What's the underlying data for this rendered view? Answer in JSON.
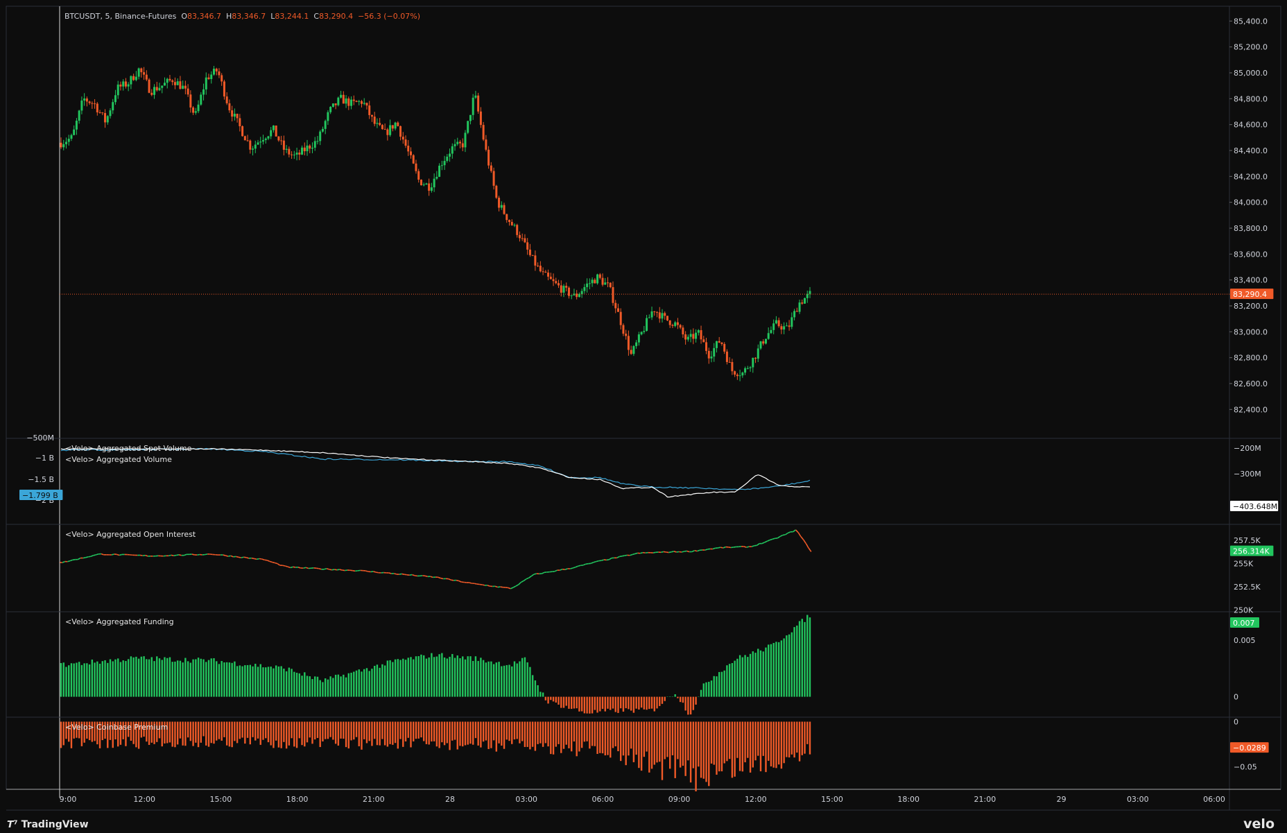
{
  "header": {
    "symbol": "BTCUSDT, 5, Binance-Futures",
    "open_label": "O",
    "open": "83,346.7",
    "high_label": "H",
    "high": "83,346.7",
    "low_label": "L",
    "low": "83,244.1",
    "close_label": "C",
    "close": "83,290.4",
    "change": "−56.3 (−0.07%)"
  },
  "branding": {
    "left": "TradingView",
    "right": "velo"
  },
  "colors": {
    "up": "#22c55e",
    "down": "#f05a28",
    "background": "#0d0d0d",
    "grid_border": "#2a2e39",
    "text": "#d1d4dc",
    "volume_spot": "#ffffff",
    "volume_agg": "#3ba6d8"
  },
  "chart_data": [
    {
      "id": "price",
      "type": "candlestick",
      "title": "",
      "ylim": [
        82300,
        85450
      ],
      "y_ticks": [
        "85,400.0",
        "85,200.0",
        "85,000.0",
        "84,800.0",
        "84,600.0",
        "84,400.0",
        "84,200.0",
        "84,000.0",
        "83,800.0",
        "83,600.0",
        "83,400.0",
        "83,200.0",
        "83,000.0",
        "82,800.0",
        "82,600.0",
        "82,400.0"
      ],
      "last_price_label": "83,290.4",
      "last_price": 83290.4,
      "keypoints": [
        [
          "09:00",
          84460
        ],
        [
          "09:20",
          84500
        ],
        [
          "10:00",
          84800
        ],
        [
          "10:40",
          84760
        ],
        [
          "11:10",
          84620
        ],
        [
          "11:40",
          84880
        ],
        [
          "12:00",
          84920
        ],
        [
          "12:20",
          85030
        ],
        [
          "12:40",
          84860
        ],
        [
          "13:20",
          84900
        ],
        [
          "14:00",
          84950
        ],
        [
          "14:40",
          84880
        ],
        [
          "15:00",
          84660
        ],
        [
          "15:30",
          84960
        ],
        [
          "15:50",
          85020
        ],
        [
          "16:10",
          84740
        ],
        [
          "16:40",
          84580
        ],
        [
          "17:10",
          84420
        ],
        [
          "17:40",
          84500
        ],
        [
          "18:10",
          84560
        ],
        [
          "18:40",
          84400
        ],
        [
          "19:10",
          84350
        ],
        [
          "19:40",
          84420
        ],
        [
          "20:10",
          84480
        ],
        [
          "20:40",
          84700
        ],
        [
          "21:20",
          84800
        ],
        [
          "21:50",
          84760
        ],
        [
          "22:20",
          84780
        ],
        [
          "22:50",
          84610
        ],
        [
          "23:20",
          84530
        ],
        [
          "23:50",
          84620
        ],
        [
          "00:10",
          84400
        ],
        [
          "00:40",
          84170
        ],
        [
          "01:00",
          84120
        ],
        [
          "01:20",
          84300
        ],
        [
          "01:40",
          84420
        ],
        [
          "02:00",
          84450
        ],
        [
          "02:20",
          84840
        ],
        [
          "02:40",
          84400
        ],
        [
          "03:00",
          84010
        ],
        [
          "03:20",
          83870
        ],
        [
          "03:40",
          83750
        ],
        [
          "04:10",
          83580
        ],
        [
          "04:40",
          83450
        ],
        [
          "05:00",
          83380
        ],
        [
          "05:30",
          83320
        ],
        [
          "05:50",
          83270
        ],
        [
          "06:20",
          83360
        ],
        [
          "06:50",
          83420
        ],
        [
          "07:20",
          83350
        ],
        [
          "07:40",
          83100
        ],
        [
          "07:50",
          82820
        ],
        [
          "08:00",
          83000
        ],
        [
          "08:30",
          83180
        ],
        [
          "09:00",
          83100
        ],
        [
          "09:30",
          83060
        ],
        [
          "10:00",
          82930
        ],
        [
          "10:30",
          82990
        ],
        [
          "11:00",
          82820
        ],
        [
          "11:30",
          82940
        ],
        [
          "11:50",
          82700
        ],
        [
          "12:20",
          82680
        ],
        [
          "12:40",
          82800
        ],
        [
          "13:10",
          82960
        ],
        [
          "13:40",
          83060
        ],
        [
          "14:00",
          83020
        ],
        [
          "14:10",
          83220
        ],
        [
          "14:20",
          83290
        ]
      ]
    },
    {
      "id": "volume",
      "type": "line",
      "series": [
        {
          "name": "<Velo> Aggregated Spot Volume"
        },
        {
          "name": "<Velo> Aggregated Volume"
        }
      ],
      "left_ticks": [
        "−500M",
        "−1 B",
        "−1.5 B",
        "−2 B"
      ],
      "right_ticks": [
        "−200M",
        "−300M"
      ],
      "left_value_label": "−1.799 B",
      "right_value_label": "−403.648M",
      "left_value": -1799000000,
      "right_value": -403648000,
      "series_keypoints": {
        "spot": [
          [
            0,
            0.1
          ],
          [
            0.2,
            0.1
          ],
          [
            0.27,
            0.12
          ],
          [
            0.35,
            0.16
          ],
          [
            0.45,
            0.25
          ],
          [
            0.55,
            0.3
          ],
          [
            0.6,
            0.33
          ],
          [
            0.64,
            0.4
          ],
          [
            0.68,
            0.55
          ],
          [
            0.72,
            0.58
          ],
          [
            0.75,
            0.72
          ],
          [
            0.79,
            0.7
          ],
          [
            0.81,
            0.85
          ],
          [
            0.87,
            0.78
          ],
          [
            0.9,
            0.78
          ],
          [
            0.93,
            0.5
          ],
          [
            0.96,
            0.68
          ],
          [
            1.0,
            0.7
          ]
        ],
        "agg": [
          [
            0,
            0.12
          ],
          [
            0.2,
            0.1
          ],
          [
            0.27,
            0.14
          ],
          [
            0.35,
            0.26
          ],
          [
            0.45,
            0.27
          ],
          [
            0.55,
            0.3
          ],
          [
            0.6,
            0.3
          ],
          [
            0.64,
            0.37
          ],
          [
            0.68,
            0.55
          ],
          [
            0.72,
            0.55
          ],
          [
            0.75,
            0.65
          ],
          [
            0.79,
            0.7
          ],
          [
            0.81,
            0.7
          ],
          [
            0.87,
            0.72
          ],
          [
            0.9,
            0.74
          ],
          [
            0.93,
            0.72
          ],
          [
            0.96,
            0.68
          ],
          [
            1.0,
            0.6
          ]
        ]
      }
    },
    {
      "id": "open_interest",
      "type": "line",
      "series": [
        {
          "name": "<Velo> Aggregated Open Interest"
        }
      ],
      "ylim": [
        249800,
        259200
      ],
      "y_ticks": [
        "257.5K",
        "255K",
        "252.5K",
        "250K"
      ],
      "last_value_label": "256.314K",
      "last_value": 256314,
      "keypoints": [
        [
          0,
          255.1
        ],
        [
          0.05,
          256.0
        ],
        [
          0.12,
          255.8
        ],
        [
          0.2,
          256.0
        ],
        [
          0.27,
          255.4
        ],
        [
          0.3,
          254.6
        ],
        [
          0.4,
          254.2
        ],
        [
          0.5,
          253.5
        ],
        [
          0.55,
          252.8
        ],
        [
          0.6,
          252.3
        ],
        [
          0.63,
          253.8
        ],
        [
          0.68,
          254.5
        ],
        [
          0.72,
          255.3
        ],
        [
          0.77,
          256.1
        ],
        [
          0.8,
          256.2
        ],
        [
          0.84,
          256.3
        ],
        [
          0.88,
          256.7
        ],
        [
          0.92,
          256.8
        ],
        [
          0.95,
          257.6
        ],
        [
          0.98,
          258.6
        ],
        [
          1.0,
          256.3
        ]
      ]
    },
    {
      "id": "funding",
      "type": "bar",
      "series": [
        {
          "name": "<Velo> Aggregated Funding"
        }
      ],
      "ylim": [
        -0.0018,
        0.0075
      ],
      "y_ticks": [
        "0.005",
        "0"
      ],
      "last_value_label": "0.007",
      "last_value": 0.007,
      "keypoints": [
        [
          0,
          0.0028
        ],
        [
          0.1,
          0.0034
        ],
        [
          0.2,
          0.0032
        ],
        [
          0.3,
          0.0025
        ],
        [
          0.35,
          0.0014
        ],
        [
          0.45,
          0.0032
        ],
        [
          0.5,
          0.0037
        ],
        [
          0.55,
          0.0034
        ],
        [
          0.6,
          0.0028
        ],
        [
          0.62,
          0.0033
        ],
        [
          0.64,
          0.0006
        ],
        [
          0.65,
          -0.0004
        ],
        [
          0.7,
          -0.0014
        ],
        [
          0.75,
          -0.0012
        ],
        [
          0.79,
          -0.0012
        ],
        [
          0.82,
          0.0004
        ],
        [
          0.84,
          -0.0016
        ],
        [
          0.86,
          0.0012
        ],
        [
          0.9,
          0.0033
        ],
        [
          0.95,
          0.0045
        ],
        [
          1.0,
          0.0072
        ]
      ]
    },
    {
      "id": "coinbase_premium",
      "type": "bar",
      "series": [
        {
          "name": "<Velo> Coinbase Premium"
        }
      ],
      "ylim": [
        -0.075,
        0.005
      ],
      "y_ticks": [
        "0",
        "−0.05"
      ],
      "last_value_label": "−0.0289",
      "last_value": -0.0289,
      "keypoints": [
        [
          0,
          -0.025
        ],
        [
          0.2,
          -0.022
        ],
        [
          0.4,
          -0.024
        ],
        [
          0.6,
          -0.026
        ],
        [
          0.7,
          -0.03
        ],
        [
          0.78,
          -0.045
        ],
        [
          0.85,
          -0.06
        ],
        [
          0.9,
          -0.05
        ],
        [
          0.95,
          -0.045
        ],
        [
          1.0,
          -0.03
        ]
      ]
    }
  ],
  "time_axis": {
    "labels": [
      "9:00",
      "12:00",
      "15:00",
      "18:00",
      "21:00",
      "28",
      "03:00",
      "06:00",
      "09:00",
      "12:00",
      "15:00",
      "18:00",
      "21:00",
      "29",
      "03:00",
      "06:00"
    ]
  }
}
